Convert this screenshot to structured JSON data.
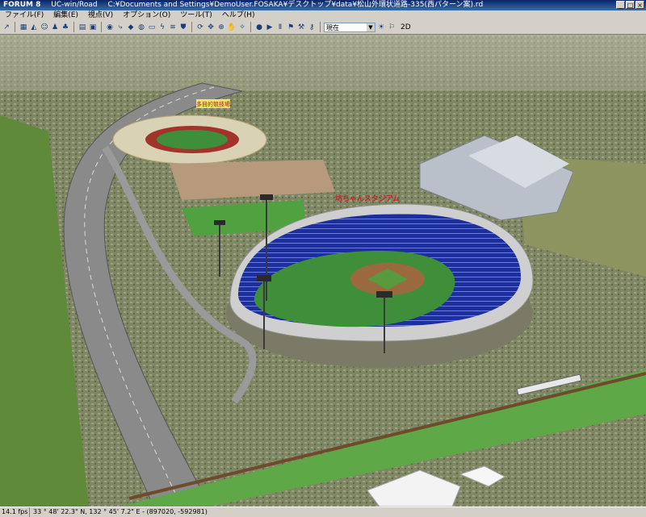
{
  "titlebar": {
    "brand": "FORUM 8",
    "app": "UC-win/Road",
    "path": "C:¥Documents and Settings¥DemoUser.FOSAKA¥デスクトップ¥data¥松山外環状道路-335(西パターン案).rd"
  },
  "menu": [
    "ファイル(F)",
    "編集(E)",
    "視点(V)",
    "オプション(O)",
    "ツール(T)",
    "ヘルプ(H)"
  ],
  "toolbar": {
    "icons": [
      "pointer-icon",
      "road-icon",
      "terrain-icon",
      "person-icon",
      "people-icon",
      "tree-icon",
      "model-icon",
      "book-icon",
      "camera-icon",
      "route-icon",
      "car-icon",
      "globe-icon",
      "bus-icon",
      "lightning-icon",
      "fog-icon",
      "shield-icon",
      "rotate-icon",
      "move-icon",
      "zoom-icon",
      "pan-icon",
      "compass-icon",
      "record-icon",
      "play-icon",
      "pause-icon",
      "traffic-icon",
      "tool-icon",
      "key-icon"
    ],
    "time_select_value": "現在",
    "mode_2d": "2D"
  },
  "scene": {
    "stadium_sign": "坊ちゃんスタジアム",
    "field_sign": "多目的競技場"
  },
  "status": {
    "fps": "14.1 fps",
    "coords": "33 ° 48' 22.3\" N, 132 ° 45' 7.2\" E - (897020, -592981)"
  },
  "colors": {
    "titlebar": "#0a246a",
    "stadium_seats": "#1c2f9c",
    "field_grass": "#3f8f3a",
    "infield_dirt": "#9a6a3e",
    "track": "#a2332a"
  }
}
